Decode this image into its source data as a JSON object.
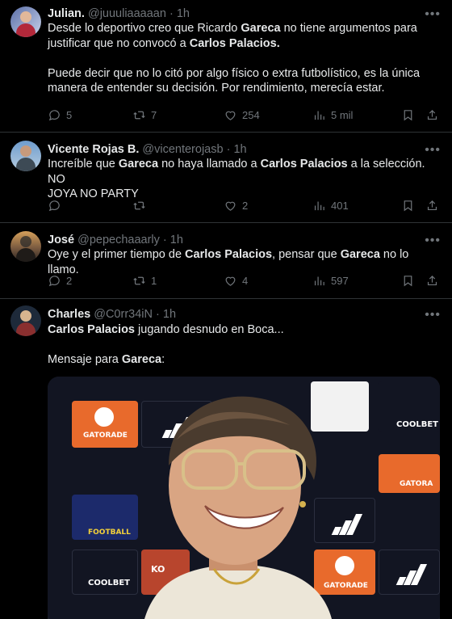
{
  "tweets": [
    {
      "name": "Julian.",
      "handle": "@juuuliaaaaan",
      "dot": "·",
      "time": "1h",
      "body": [
        [
          {
            "t": "Desde lo deportivo creo que Ricardo "
          },
          {
            "t": "Gareca",
            "b": true
          },
          {
            "t": " no tiene argumentos para"
          }
        ],
        [
          {
            "t": "justificar que no convocó a "
          },
          {
            "t": "Carlos Palacios.",
            "b": true
          }
        ],
        [],
        [
          {
            "t": "Puede decir que no lo citó por algo físico o extra futbolístico, es la única"
          }
        ],
        [
          {
            "t": "manera de entender su decisión. Por rendimiento, merecía estar."
          }
        ]
      ],
      "replies": "5",
      "reposts": "7",
      "likes": "254",
      "views": "5 mil"
    },
    {
      "name": "Vicente Rojas B.",
      "handle": "@vicenterojasb",
      "dot": "·",
      "time": "1h",
      "body": [
        [
          {
            "t": "Increíble que "
          },
          {
            "t": "Gareca",
            "b": true
          },
          {
            "t": " no haya llamado a "
          },
          {
            "t": "Carlos Palacios",
            "b": true
          },
          {
            "t": " a la selección.  NO"
          }
        ],
        [
          {
            "t": "JOYA NO PARTY"
          }
        ]
      ],
      "replies": "",
      "reposts": "",
      "likes": "2",
      "views": "401"
    },
    {
      "name": "José",
      "handle": "@pepechaaarly",
      "dot": "·",
      "time": "1h",
      "body": [
        [
          {
            "t": "Oye y el primer tiempo de "
          },
          {
            "t": "Carlos Palacios",
            "b": true
          },
          {
            "t": ", pensar que "
          },
          {
            "t": "Gareca",
            "b": true
          },
          {
            "t": " no lo llamo."
          }
        ]
      ],
      "replies": "2",
      "reposts": "1",
      "likes": "4",
      "views": "597"
    },
    {
      "name": "Charles",
      "handle": "@C0rr34iN",
      "dot": "·",
      "time": "1h",
      "body": [
        [
          {
            "t": "Carlos Palacios",
            "b": true
          },
          {
            "t": " jugando desnudo en Boca..."
          }
        ],
        [],
        [
          {
            "t": "Mensaje para "
          },
          {
            "t": "Gareca",
            "b": true
          },
          {
            "t": ":"
          }
        ]
      ]
    }
  ],
  "media": {
    "sponsors": [
      "GATORADE",
      "COOLBET",
      "FOOTBALL",
      "GATORA",
      "KO"
    ]
  },
  "icons": {
    "reply": "reply-icon",
    "repost": "repost-icon",
    "like": "heart-icon",
    "views": "views-icon",
    "bookmark": "bookmark-icon",
    "share": "share-icon",
    "more": "more-icon"
  }
}
